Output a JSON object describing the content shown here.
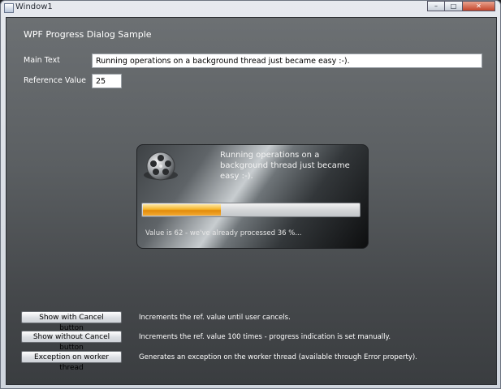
{
  "window": {
    "title": "Window1",
    "controls": {
      "minimize": "–",
      "maximize": "□",
      "close": "✕"
    }
  },
  "page": {
    "title": "WPF Progress Dialog Sample"
  },
  "form": {
    "main_text_label": "Main Text",
    "main_text_value": "Running operations on a background thread just became easy :-).",
    "reference_label": "Reference Value",
    "reference_value": "25"
  },
  "dialog": {
    "icon": "film-reel-icon",
    "text": "Running operations on a background thread just became easy :-).",
    "progress_percent": 36,
    "status": "Value is 62 - we've already processed 36 %..."
  },
  "actions": [
    {
      "label": "Show with Cancel button",
      "description": "Increments the ref. value until user cancels."
    },
    {
      "label": "Show without Cancel button",
      "description": "Increments the ref. value 100 times - progress indication is set manually."
    },
    {
      "label": "Exception on worker thread",
      "description": "Generates an exception on the worker thread (available through Error property)."
    }
  ],
  "colors": {
    "progress_fill": "#f6b52b",
    "client_background": "#5b5f62"
  }
}
